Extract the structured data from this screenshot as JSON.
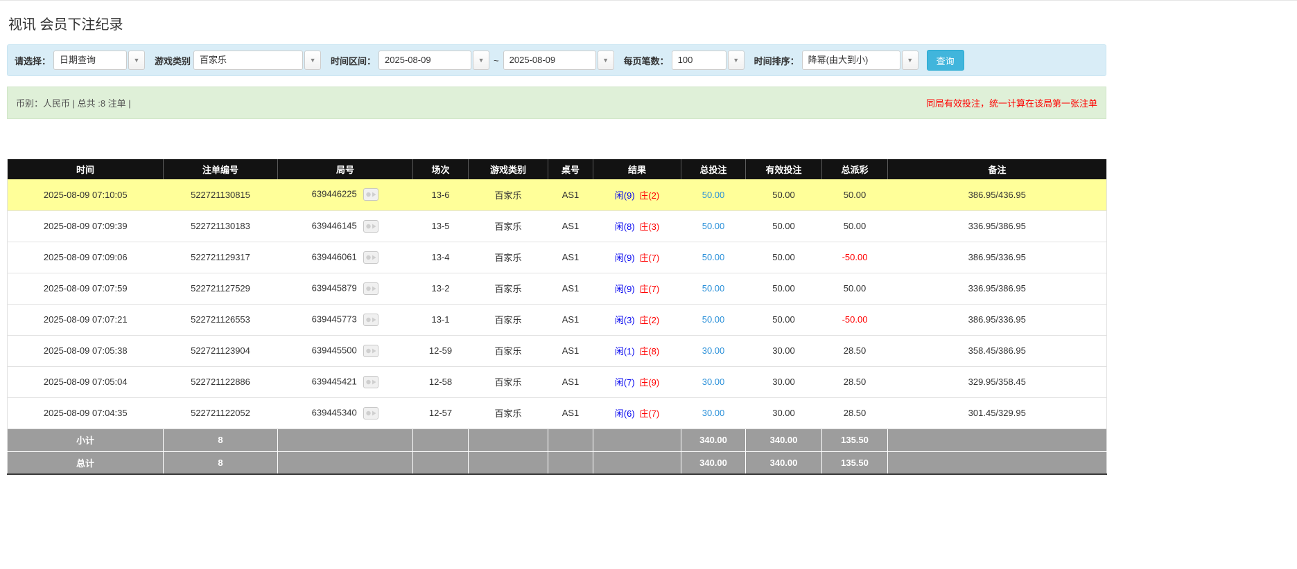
{
  "page": {
    "title": "视讯 会员下注纪录"
  },
  "filters": {
    "select_label": "请选择：",
    "select_value": "日期查询",
    "game_type_label": "游戏类别",
    "game_type_value": "百家乐",
    "date_range_label": "时间区间：",
    "date_from": "2025-08-09",
    "date_to": "2025-08-09",
    "range_separator": "~",
    "page_size_label": "每页笔数：",
    "page_size_value": "100",
    "sort_label": "时间排序：",
    "sort_value": "降幂(由大到小)",
    "search_button": "查询",
    "dropdown_arrow": "▼"
  },
  "summary": {
    "left": "币别：人民币 | 总共 :8 注单 |",
    "right": "同局有效投注，统一计算在该局第一张注单"
  },
  "table": {
    "headers": [
      "时间",
      "注单编号",
      "局号",
      "场次",
      "游戏类别",
      "桌号",
      "结果",
      "总投注",
      "有效投注",
      "总派彩",
      "备注"
    ],
    "rows": [
      {
        "time": "2025-08-09 07:10:05",
        "bet_id": "522721130815",
        "round": "639446225",
        "session": "13-6",
        "game": "百家乐",
        "table_no": "AS1",
        "result_player": "闲(9)",
        "result_banker": "庄(2)",
        "total_bet": "50.00",
        "valid_bet": "50.00",
        "payout": "50.00",
        "note": "386.95/436.95",
        "highlight": true
      },
      {
        "time": "2025-08-09 07:09:39",
        "bet_id": "522721130183",
        "round": "639446145",
        "session": "13-5",
        "game": "百家乐",
        "table_no": "AS1",
        "result_player": "闲(8)",
        "result_banker": "庄(3)",
        "total_bet": "50.00",
        "valid_bet": "50.00",
        "payout": "50.00",
        "note": "336.95/386.95",
        "highlight": false
      },
      {
        "time": "2025-08-09 07:09:06",
        "bet_id": "522721129317",
        "round": "639446061",
        "session": "13-4",
        "game": "百家乐",
        "table_no": "AS1",
        "result_player": "闲(9)",
        "result_banker": "庄(7)",
        "total_bet": "50.00",
        "valid_bet": "50.00",
        "payout": "-50.00",
        "note": "386.95/336.95",
        "highlight": false
      },
      {
        "time": "2025-08-09 07:07:59",
        "bet_id": "522721127529",
        "round": "639445879",
        "session": "13-2",
        "game": "百家乐",
        "table_no": "AS1",
        "result_player": "闲(9)",
        "result_banker": "庄(7)",
        "total_bet": "50.00",
        "valid_bet": "50.00",
        "payout": "50.00",
        "note": "336.95/386.95",
        "highlight": false
      },
      {
        "time": "2025-08-09 07:07:21",
        "bet_id": "522721126553",
        "round": "639445773",
        "session": "13-1",
        "game": "百家乐",
        "table_no": "AS1",
        "result_player": "闲(3)",
        "result_banker": "庄(2)",
        "total_bet": "50.00",
        "valid_bet": "50.00",
        "payout": "-50.00",
        "note": "386.95/336.95",
        "highlight": false
      },
      {
        "time": "2025-08-09 07:05:38",
        "bet_id": "522721123904",
        "round": "639445500",
        "session": "12-59",
        "game": "百家乐",
        "table_no": "AS1",
        "result_player": "闲(1)",
        "result_banker": "庄(8)",
        "total_bet": "30.00",
        "valid_bet": "30.00",
        "payout": "28.50",
        "note": "358.45/386.95",
        "highlight": false
      },
      {
        "time": "2025-08-09 07:05:04",
        "bet_id": "522721122886",
        "round": "639445421",
        "session": "12-58",
        "game": "百家乐",
        "table_no": "AS1",
        "result_player": "闲(7)",
        "result_banker": "庄(9)",
        "total_bet": "30.00",
        "valid_bet": "30.00",
        "payout": "28.50",
        "note": "329.95/358.45",
        "highlight": false
      },
      {
        "time": "2025-08-09 07:04:35",
        "bet_id": "522721122052",
        "round": "639445340",
        "session": "12-57",
        "game": "百家乐",
        "table_no": "AS1",
        "result_player": "闲(6)",
        "result_banker": "庄(7)",
        "total_bet": "30.00",
        "valid_bet": "30.00",
        "payout": "28.50",
        "note": "301.45/329.95",
        "highlight": false
      }
    ],
    "subtotal": {
      "label": "小计",
      "count": "8",
      "total_bet": "340.00",
      "valid_bet": "340.00",
      "payout": "135.50"
    },
    "total": {
      "label": "总计",
      "count": "8",
      "total_bet": "340.00",
      "valid_bet": "340.00",
      "payout": "135.50"
    }
  }
}
